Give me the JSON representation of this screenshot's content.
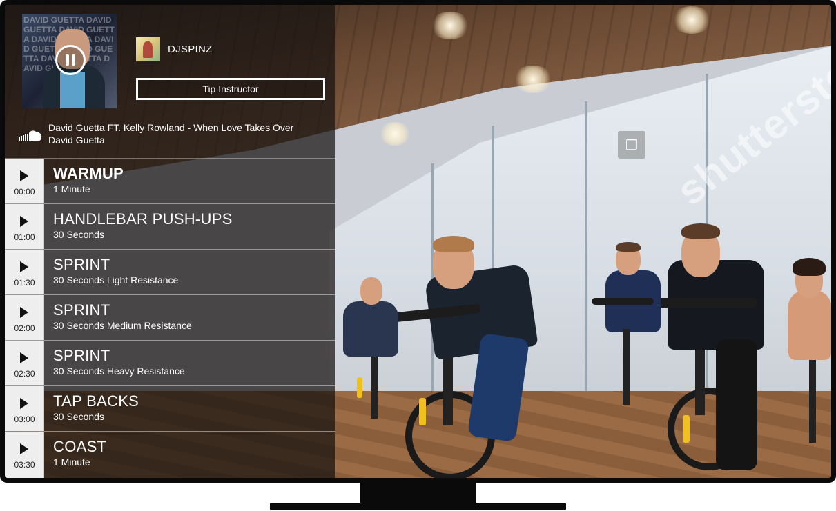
{
  "now_playing": {
    "state": "paused",
    "pause_icon": "pause-icon",
    "track_title": "David Guetta FT. Kelly Rowland - When Love Takes Over",
    "track_artist": "David Guetta",
    "source_icon": "soundcloud-icon",
    "album_art_text": "DAVID GUETTA DAVID GUETTA DAVID GUETTA DAVID GUETTA DAVID GUETTA DAVID GUETTA DAVID GUETTA DAVID GUETTA"
  },
  "instructor": {
    "name": "DJSPINZ",
    "tip_button_label": "Tip Instructor"
  },
  "workout": {
    "items": [
      {
        "time": "00:00",
        "name": "WARMUP",
        "description": "1 Minute",
        "active": true
      },
      {
        "time": "01:00",
        "name": "HANDLEBAR PUSH-UPS",
        "description": "30 Seconds",
        "active": false
      },
      {
        "time": "01:30",
        "name": "SPRINT",
        "description": "30 Seconds Light Resistance",
        "active": false
      },
      {
        "time": "02:00",
        "name": "SPRINT",
        "description": "30 Seconds Medium Resistance",
        "active": false
      },
      {
        "time": "02:30",
        "name": "SPRINT",
        "description": "30 Seconds Heavy Resistance",
        "active": false
      },
      {
        "time": "03:00",
        "name": "TAP BACKS",
        "description": "30 Seconds",
        "active": false
      },
      {
        "time": "03:30",
        "name": "COAST",
        "description": "1 Minute",
        "active": false
      }
    ]
  },
  "background": {
    "watermark_text": "shutterstock",
    "colors": {
      "ceiling": "#6b4a33",
      "windows": "#e9eef3",
      "floor": "#9a6b45",
      "accent": "#f0c020"
    }
  }
}
